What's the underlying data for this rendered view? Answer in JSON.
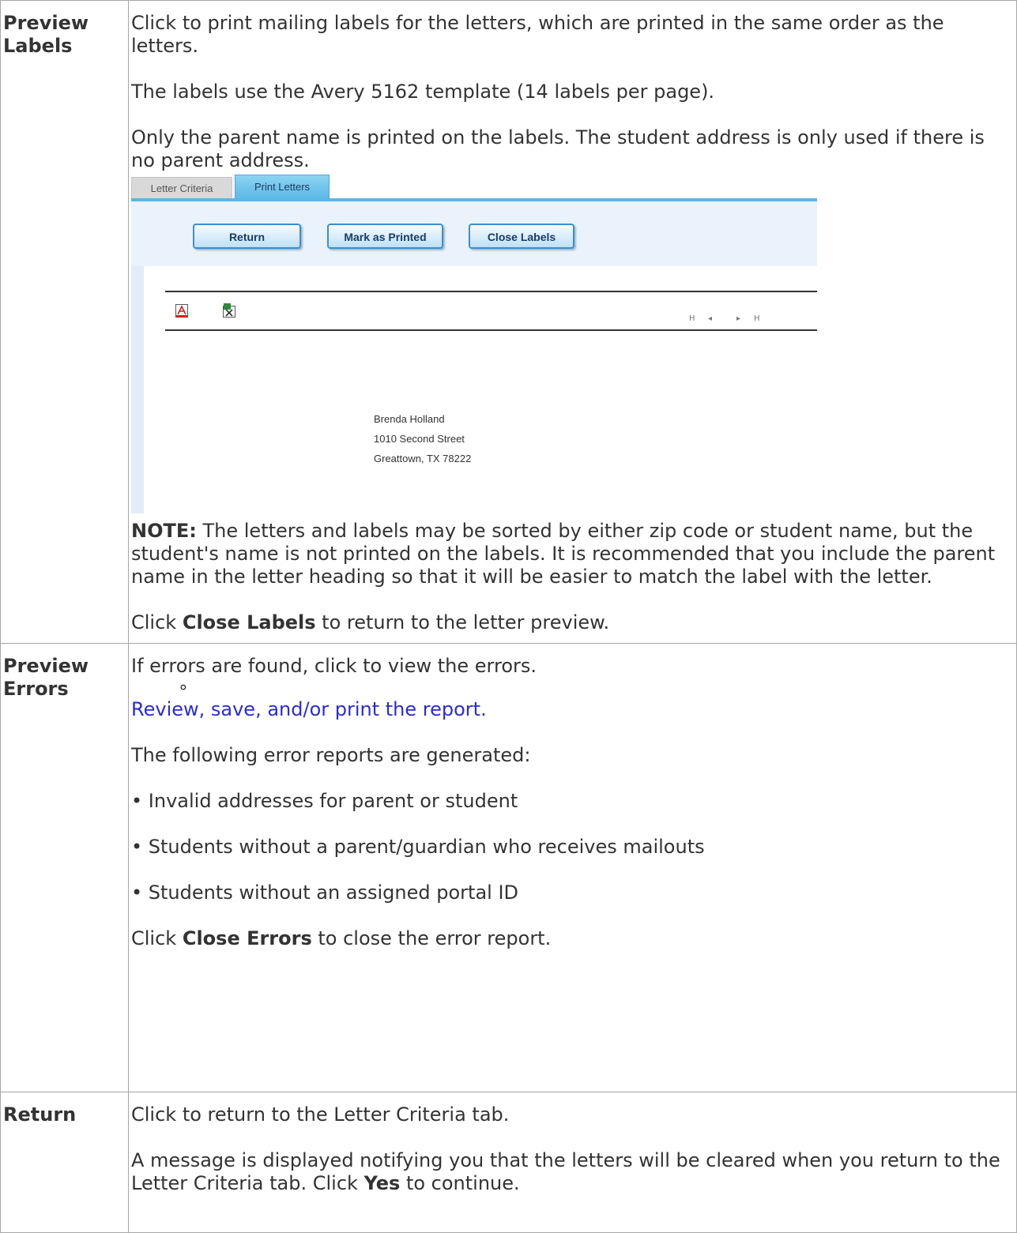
{
  "rows": [
    {
      "term": "Preview Labels",
      "intro": "Click to print mailing labels for the letters, which are printed in the same order as the letters.",
      "template_note": "The labels use the Avery 5162 template (14 labels per page).",
      "address_note": "Only the parent name is printed on the labels. The student address is only used if there is no parent address.",
      "screenshot": {
        "tabs": [
          "Letter Criteria",
          "Print Letters"
        ],
        "buttons": [
          "Return",
          "Mark as Printed",
          "Close Labels"
        ],
        "icons": [
          "pdf-icon",
          "excel-icon"
        ],
        "pager": [
          "first-page-icon",
          "prev-page-icon",
          "next-page-icon",
          "last-page-icon"
        ],
        "label_lines": [
          "Brenda Holland",
          "1010 Second Street",
          "Greattown, TX 78222"
        ]
      },
      "note_label": "NOTE:",
      "note_text": " The letters and labels may be sorted by either zip code or student name, but the student's name is not printed on the labels. It is recommended that you include the parent name in the letter heading so that it will be easier to match the label with the letter.",
      "close_prefix": "Click ",
      "close_bold": "Close Labels",
      "close_suffix": " to return to the letter preview."
    },
    {
      "term": "Preview Errors",
      "intro": "If errors are found, click to view the errors.",
      "bullet_marker": "∘",
      "link_text": "Review, save, and/or print the report.",
      "generated_text": "The following error reports are generated:",
      "bullets": [
        "• Invalid addresses for parent or student",
        "• Students without a parent/guardian who receives mailouts",
        "• Students without an assigned portal ID"
      ],
      "close_prefix": "Click ",
      "close_bold": "Close Errors",
      "close_suffix": " to close the error report."
    },
    {
      "term": "Return",
      "intro": "Click to return to the Letter Criteria tab.",
      "msg_prefix": "A message is displayed notifying you that the letters will be cleared when you return to the Letter Criteria tab. Click ",
      "msg_bold": "Yes",
      "msg_suffix": " to continue."
    }
  ]
}
